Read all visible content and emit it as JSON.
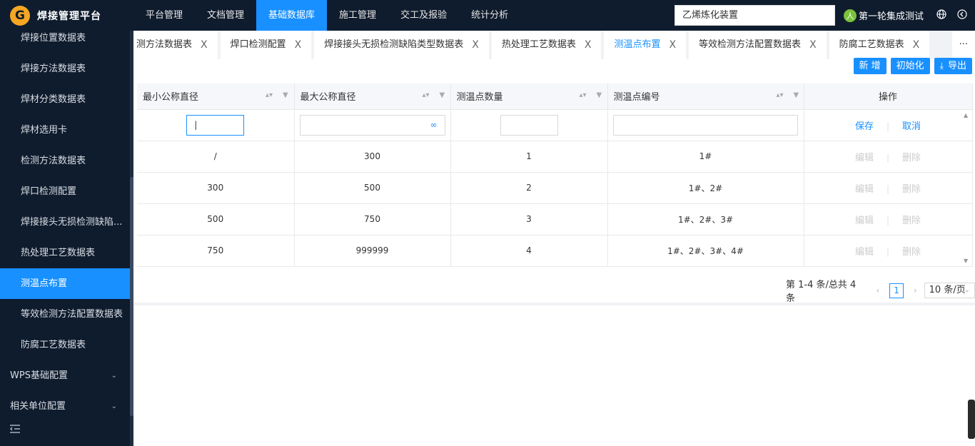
{
  "app": {
    "title": "焊接管理平台",
    "logo_letter": "G"
  },
  "nav": [
    "平台管理",
    "文档管理",
    "基础数据库",
    "施工管理",
    "交工及报验",
    "统计分析"
  ],
  "nav_active": 2,
  "project": "乙烯炼化装置",
  "user": {
    "name": "第一轮集成测试",
    "avatar_glyph": "人"
  },
  "sidebar": {
    "items": [
      "焊接位置数据表",
      "焊接方法数据表",
      "焊材分类数据表",
      "焊材选用卡",
      "检测方法数据表",
      "焊口检测配置",
      "焊接接头无损检测缺陷...",
      "热处理工艺数据表",
      "测温点布置",
      "等效检测方法配置数据表",
      "防腐工艺数据表"
    ],
    "active": 8,
    "groups": [
      "WPS基础配置",
      "相关单位配置"
    ]
  },
  "tabs": [
    "测方法数据表",
    "焊口检测配置",
    "焊接接头无损检测缺陷类型数据表",
    "热处理工艺数据表",
    "测温点布置",
    "等效检测方法配置数据表",
    "防腐工艺数据表"
  ],
  "tab_active": 4,
  "tab_more": "···",
  "toolbar": {
    "add": "新 增",
    "init": "初始化",
    "export": "导出"
  },
  "table": {
    "columns": [
      "最小公称直径",
      "最大公称直径",
      "测温点数量",
      "测温点编号",
      "操作"
    ],
    "edit_row": {
      "save": "保存",
      "cancel": "取消",
      "infinity": "∞"
    },
    "rows": [
      [
        "/",
        "300",
        "1",
        "1#"
      ],
      [
        "300",
        "500",
        "2",
        "1#、2#"
      ],
      [
        "500",
        "750",
        "3",
        "1#、2#、3#"
      ],
      [
        "750",
        "999999",
        "4",
        "1#、2#、3#、4#"
      ]
    ],
    "row_actions": {
      "edit": "编辑",
      "delete": "删除"
    }
  },
  "pager": {
    "summary": "第 1-4 条/总共 4 条",
    "current": "1",
    "size": "10 条/页"
  }
}
